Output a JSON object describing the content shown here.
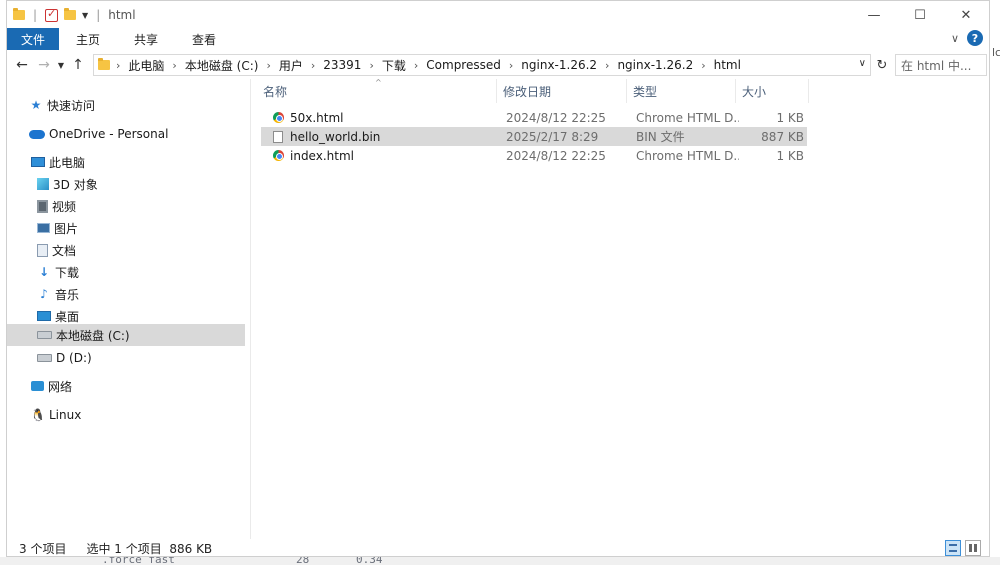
{
  "title": "html",
  "ribbon": {
    "file": "文件",
    "tabs": [
      "主页",
      "共享",
      "查看"
    ]
  },
  "breadcrumb": [
    "此电脑",
    "本地磁盘 (C:)",
    "用户",
    "23391",
    "下载",
    "Compressed",
    "nginx-1.26.2",
    "nginx-1.26.2",
    "html"
  ],
  "search": {
    "placeholder": "在 html 中..."
  },
  "nav": {
    "quick_access": "快速访问",
    "onedrive": "OneDrive - Personal",
    "this_pc": "此电脑",
    "folders": [
      "3D 对象",
      "视频",
      "图片",
      "文档",
      "下载",
      "音乐",
      "桌面"
    ],
    "drive_c": "本地磁盘 (C:)",
    "drive_d": "D (D:)",
    "network": "网络",
    "linux": "Linux"
  },
  "columns": {
    "name": "名称",
    "date": "修改日期",
    "type": "类型",
    "size": "大小"
  },
  "files": [
    {
      "name": "50x.html",
      "date": "2024/8/12 22:25",
      "type": "Chrome HTML D...",
      "size": "1 KB",
      "icon": "chrome-html-icon",
      "selected": false
    },
    {
      "name": "hello_world.bin",
      "date": "2025/2/17 8:29",
      "type": "BIN 文件",
      "size": "887 KB",
      "icon": "file-icon",
      "selected": true
    },
    {
      "name": "index.html",
      "date": "2024/8/12 22:25",
      "type": "Chrome HTML D...",
      "size": "1 KB",
      "icon": "chrome-html-icon",
      "selected": false
    }
  ],
  "status": {
    "count": "3 个项目",
    "selection": "选中 1 个项目  886 KB"
  },
  "background": {
    "terminal_text": ".force fast",
    "num1": "28",
    "num2": "0.34"
  }
}
